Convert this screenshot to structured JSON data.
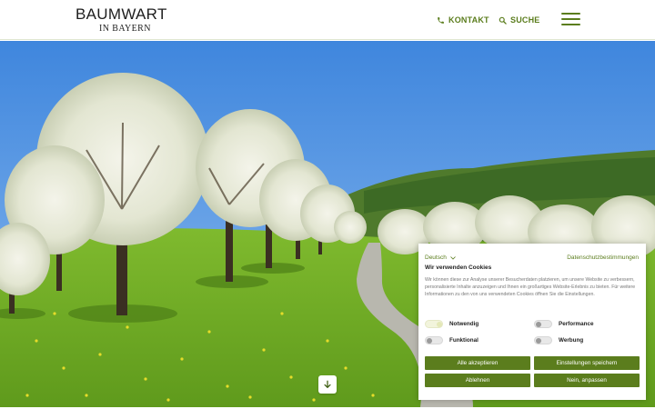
{
  "header": {
    "logo_main": "BAUMWART",
    "logo_sub": "IN BAYERN",
    "nav": {
      "contact_label": "KONTAKT",
      "search_label": "SUCHE"
    },
    "menu_icon": "hamburger-icon",
    "accent_color": "#5b7d1d"
  },
  "hero": {
    "scroll_icon": "arrow-down-icon"
  },
  "cookie_banner": {
    "language": "Deutsch",
    "privacy_link": "Datenschutzbestimmungen",
    "title": "Wir verwenden Cookies",
    "text": "Wir können diese zur Analyse unserer Besucherdaten platzieren, um unsere Website zu verbessern, personalisierte Inhalte anzuzeigen und Ihnen ein großartiges Website-Erlebnis zu bieten. Für weitere Informationen zu den von uns verwendeten Cookies öffnen Sie die Einstellungen.",
    "options": {
      "necessary": "Notwendig",
      "performance": "Performance",
      "functional": "Funktional",
      "advertising": "Werbung"
    },
    "buttons": {
      "accept_all": "Alle akzeptieren",
      "save_settings": "Einstellungen speichern",
      "reject": "Ablehnen",
      "adjust": "Nein, anpassen"
    }
  }
}
